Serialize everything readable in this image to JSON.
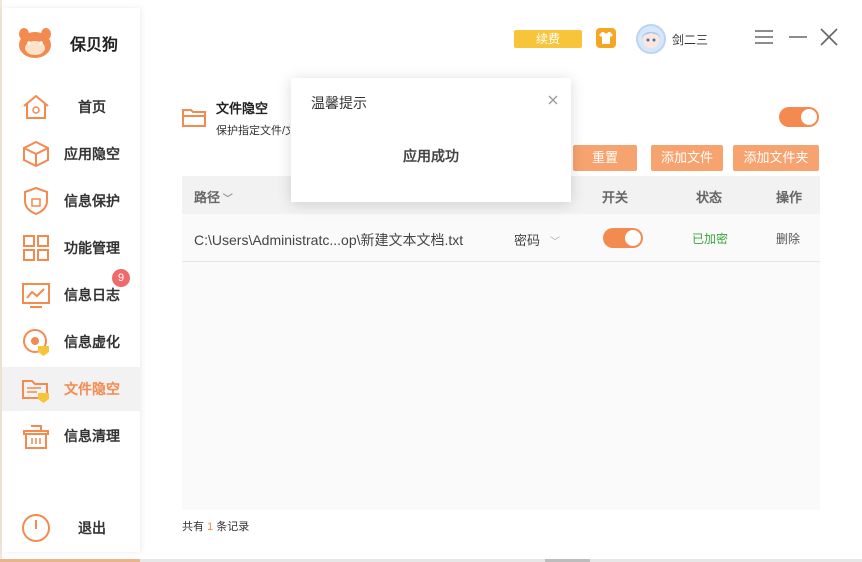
{
  "app": {
    "name": "保贝狗"
  },
  "header": {
    "renew_label": "续费",
    "username": "剑二三"
  },
  "sidebar": {
    "items": [
      {
        "label": "首页"
      },
      {
        "label": "应用隐空"
      },
      {
        "label": "信息保护"
      },
      {
        "label": "功能管理"
      },
      {
        "label": "信息日志",
        "badge": "9"
      },
      {
        "label": "信息虚化"
      },
      {
        "label": "文件隐空",
        "active": true
      },
      {
        "label": "信息清理"
      }
    ],
    "exit_label": "退出"
  },
  "section": {
    "title": "文件隐空",
    "subtitle": "保护指定文件/文件夹",
    "enabled": true
  },
  "actions": {
    "reset": "重置",
    "add_file": "添加文件",
    "add_folder": "添加文件夹"
  },
  "table": {
    "headers": {
      "path": "路径",
      "switch": "开关",
      "status": "状态",
      "op": "操作"
    },
    "rows": [
      {
        "path": "C:\\Users\\Administratc...op\\新建文本文档.txt",
        "mode": "密码",
        "switch_on": true,
        "status": "已加密",
        "op": "删除"
      }
    ]
  },
  "footer": {
    "prefix": "共有",
    "count": "1",
    "suffix": "条记录"
  },
  "dialog": {
    "title": "温馨提示",
    "message": "应用成功"
  },
  "colors": {
    "accent": "#f38a4f",
    "accent_light": "#f6a370",
    "renew": "#f8c53a",
    "status_ok": "#3aa53a",
    "badge": "#ef6a6a"
  }
}
